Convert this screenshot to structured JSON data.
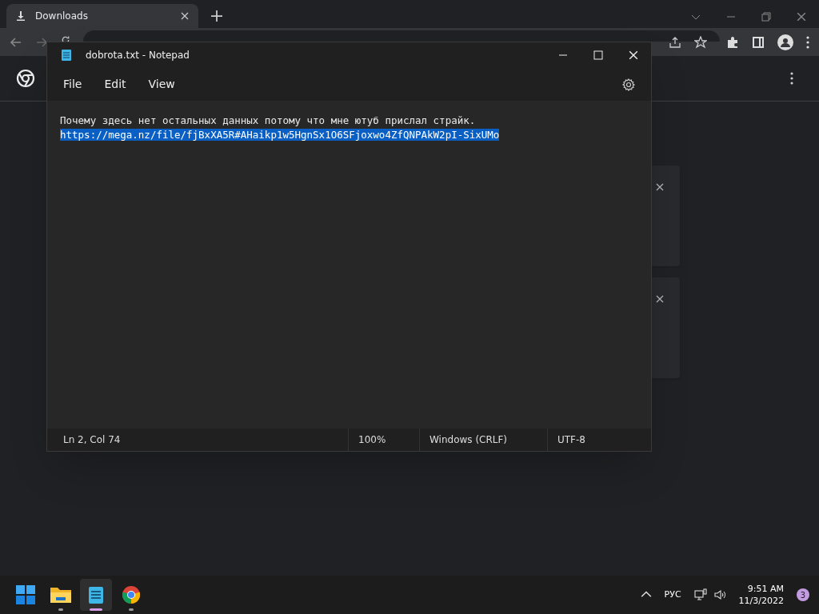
{
  "browser": {
    "tab": {
      "title": "Downloads"
    }
  },
  "notepad": {
    "title": "dobrota.txt - Notepad",
    "menu": [
      "File",
      "Edit",
      "View"
    ],
    "lines": [
      {
        "text": "Почему здесь нет остальных данных потому что мне ютуб прислал страйк.",
        "selected": false
      },
      {
        "text": "https://mega.nz/file/fjBxXA5R#AHaikp1w5HgnSx1O6SFjoxwo4ZfQNPAkW2pI-SixUMo",
        "selected": true
      }
    ],
    "status": [
      "Ln 2, Col 74",
      "100%",
      "Windows (CRLF)",
      "UTF-8"
    ]
  },
  "taskbar": {
    "apps": [
      {
        "kind": "start",
        "selected": false
      },
      {
        "kind": "explorer",
        "selected": false
      },
      {
        "kind": "notepad",
        "selected": true
      },
      {
        "kind": "chrome",
        "selected": false
      }
    ],
    "language": "РУС",
    "time": "9:51 AM",
    "date": "11/3/2022",
    "notifications": "3"
  }
}
